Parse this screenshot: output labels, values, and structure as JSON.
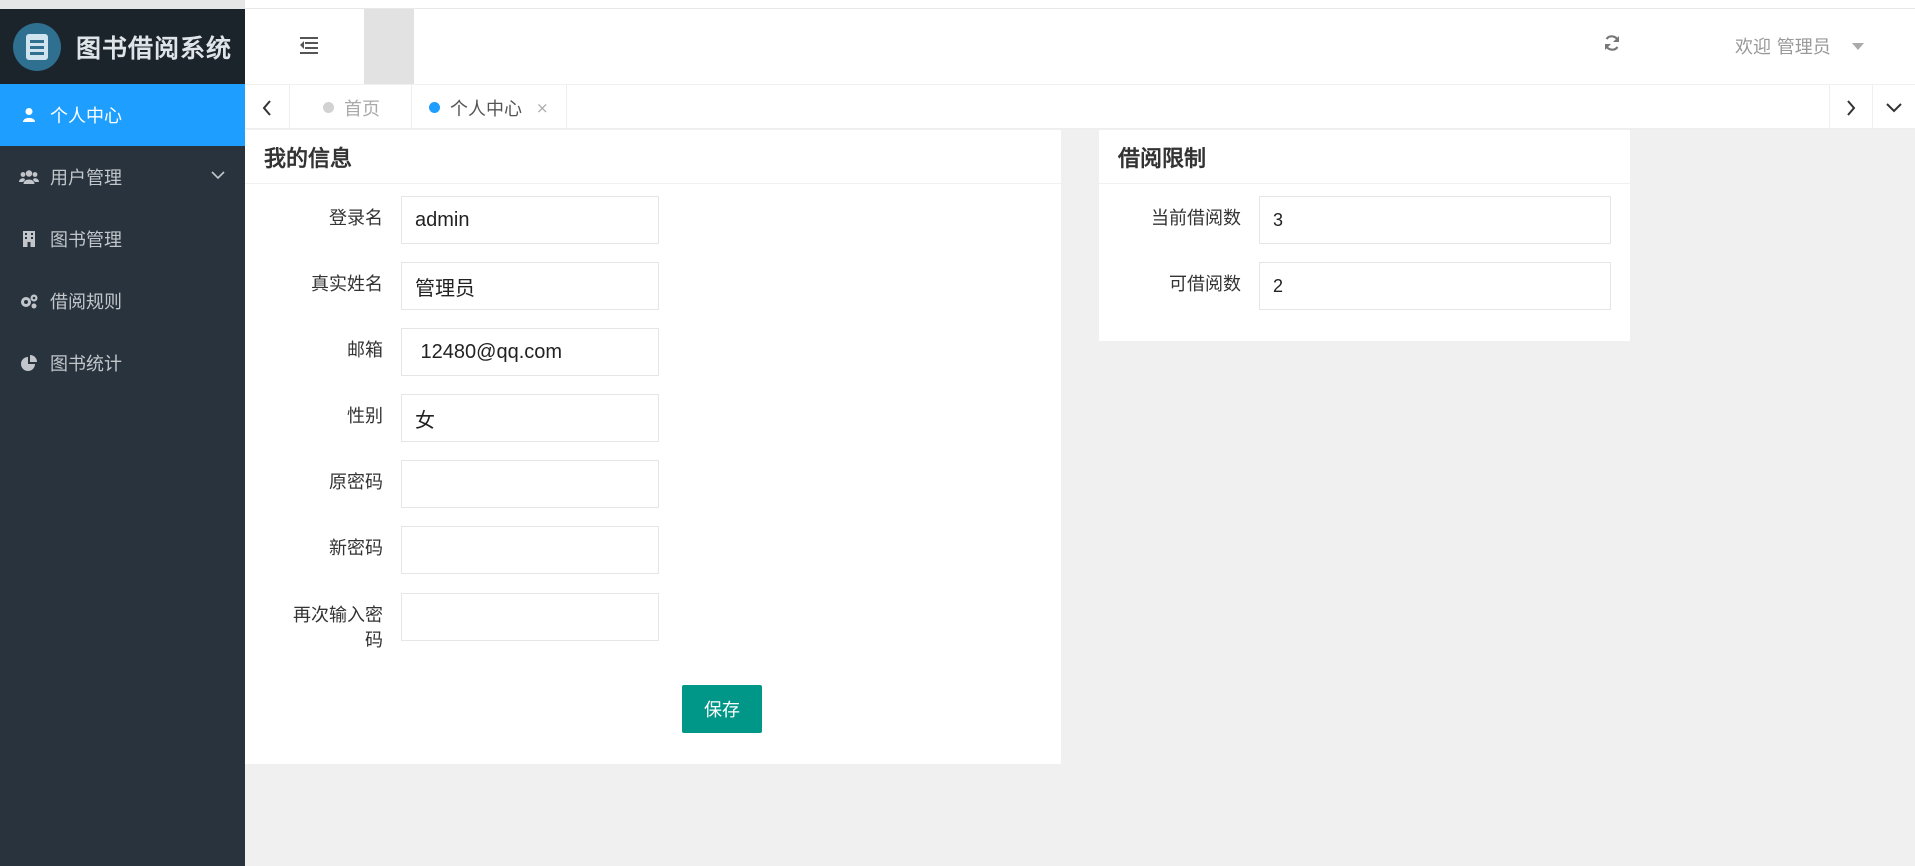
{
  "app": {
    "title": "图书借阅系统"
  },
  "sidebar": {
    "items": [
      {
        "label": "个人中心",
        "icon": "user-icon",
        "active": true
      },
      {
        "label": "用户管理",
        "icon": "users-icon",
        "has_submenu": true
      },
      {
        "label": "图书管理",
        "icon": "building-icon"
      },
      {
        "label": "借阅规则",
        "icon": "gears-icon"
      },
      {
        "label": "图书统计",
        "icon": "pie-chart-icon"
      }
    ]
  },
  "header": {
    "welcome": "欢迎 管理员"
  },
  "tabs": [
    {
      "label": "首页"
    },
    {
      "label": "个人中心",
      "closable": true,
      "close_glyph": "×"
    }
  ],
  "my_info": {
    "title": "我的信息",
    "fields": [
      {
        "label": "登录名",
        "value": "admin"
      },
      {
        "label": "真实姓名",
        "value": "管理员"
      },
      {
        "label": "邮箱",
        "value": " 12480@qq.com"
      },
      {
        "label": "性别",
        "value": "女"
      },
      {
        "label": "原密码",
        "value": ""
      },
      {
        "label": "新密码",
        "value": ""
      },
      {
        "label": "再次输入密码",
        "value": ""
      }
    ],
    "save_label": "保存"
  },
  "borrow_limit": {
    "title": "借阅限制",
    "fields": [
      {
        "label": "当前借阅数",
        "value": "3"
      },
      {
        "label": "可借阅数",
        "value": "2"
      }
    ]
  },
  "colors": {
    "accent": "#1e9fff",
    "sidebar": "#28333e",
    "save_button": "#009688"
  }
}
